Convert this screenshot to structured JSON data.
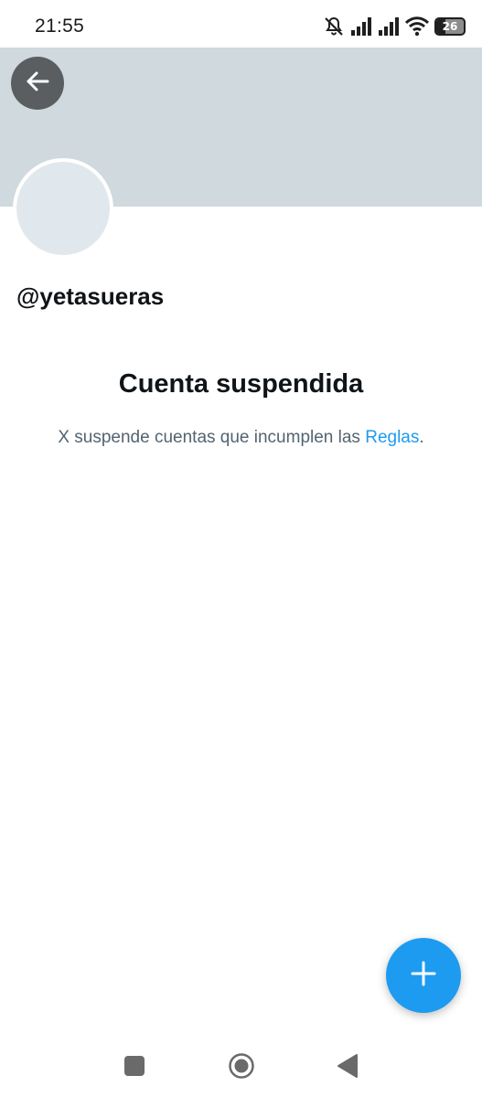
{
  "status_bar": {
    "time": "21:55",
    "battery_level": "26",
    "icons": [
      "mute-bell-icon",
      "signal-icon",
      "signal-icon",
      "wifi-icon",
      "battery-icon"
    ]
  },
  "header": {
    "back_icon": "arrow-left-icon",
    "banner_color": "#cfd9de"
  },
  "profile": {
    "handle": "@yetasueras"
  },
  "suspension": {
    "title": "Cuenta suspendida",
    "message": "X suspende cuentas que incumplen las ",
    "link_text": "Reglas",
    "message_end": "."
  },
  "fab": {
    "icon": "plus-icon",
    "color": "#1d9bf0"
  },
  "navigation": {
    "icons": [
      "recents-square-icon",
      "home-circle-icon",
      "back-triangle-icon"
    ]
  },
  "colors": {
    "accent": "#1d9bf0",
    "text_primary": "#0f1419",
    "text_secondary": "#536471"
  }
}
